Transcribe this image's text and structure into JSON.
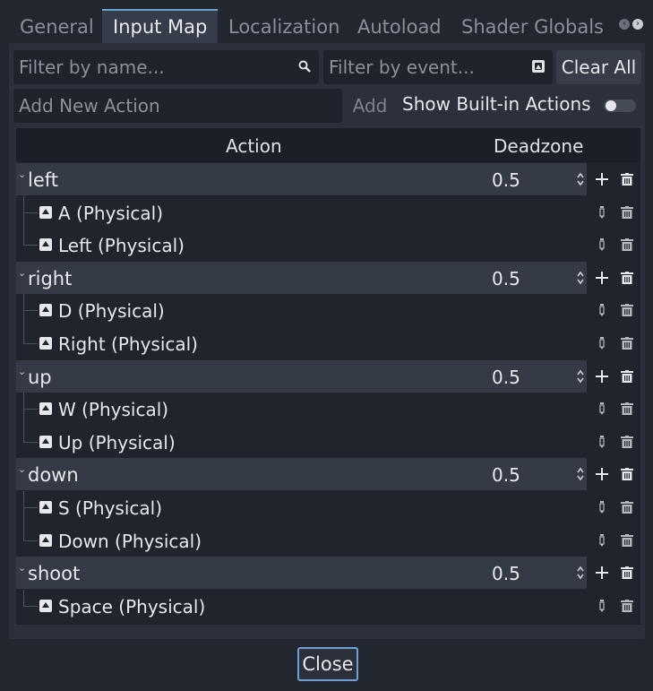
{
  "tabs": [
    {
      "label": "General",
      "active": false
    },
    {
      "label": "Input Map",
      "active": true
    },
    {
      "label": "Localization",
      "active": false
    },
    {
      "label": "Autoload",
      "active": false
    },
    {
      "label": "Shader Globals",
      "active": false
    }
  ],
  "filters": {
    "name_placeholder": "Filter by name...",
    "event_placeholder": "Filter by event...",
    "clear_all_label": "Clear All"
  },
  "add_action": {
    "placeholder": "Add New Action",
    "add_label": "Add",
    "show_builtin_label": "Show Built-in Actions",
    "show_builtin_enabled": false
  },
  "tree": {
    "col_action": "Action",
    "col_deadzone": "Deadzone",
    "actions": [
      {
        "name": "left",
        "deadzone": "0.5",
        "events": [
          "A (Physical)",
          "Left (Physical)"
        ]
      },
      {
        "name": "right",
        "deadzone": "0.5",
        "events": [
          "D (Physical)",
          "Right (Physical)"
        ]
      },
      {
        "name": "up",
        "deadzone": "0.5",
        "events": [
          "W (Physical)",
          "Up (Physical)"
        ]
      },
      {
        "name": "down",
        "deadzone": "0.5",
        "events": [
          "S (Physical)",
          "Down (Physical)"
        ]
      },
      {
        "name": "shoot",
        "deadzone": "0.5",
        "events": [
          "Space (Physical)"
        ]
      }
    ]
  },
  "footer": {
    "close_label": "Close"
  },
  "colors": {
    "accent": "#6ea0d6",
    "panel": "#2b303b",
    "background": "#21262f"
  }
}
